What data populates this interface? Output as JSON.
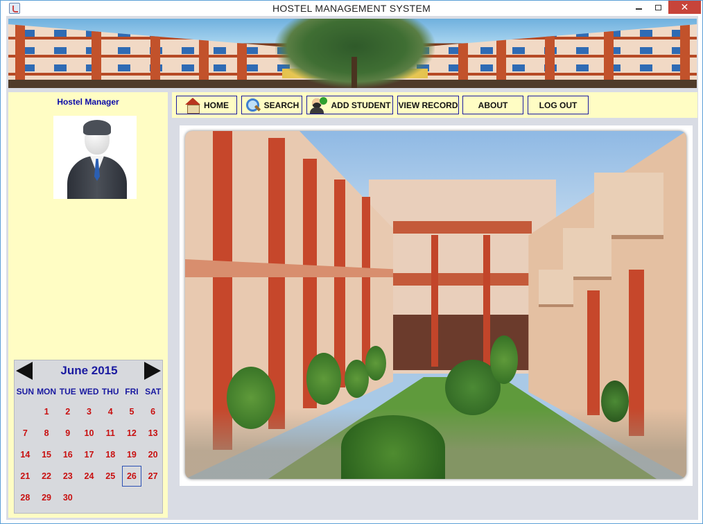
{
  "window": {
    "title": "HOSTEL MANAGEMENT SYSTEM",
    "close_symbol": "✕"
  },
  "sidebar": {
    "manager_label": "Hostel Manager"
  },
  "toolbar": {
    "home": "HOME",
    "search": "SEARCH",
    "add_student": "ADD STUDENT",
    "view_record": "VIEW RECORD",
    "about": "ABOUT",
    "logout": "LOG OUT"
  },
  "calendar": {
    "month_label": "June 2015",
    "weekdays": [
      "SUN",
      "MON",
      "TUE",
      "WED",
      "THU",
      "FRI",
      "SAT"
    ],
    "first_weekday_index": 1,
    "days_in_month": 30,
    "selected_day": 26
  },
  "colors": {
    "panel_bg": "#fffdc4",
    "accent_text": "#1a1aa0",
    "day_text": "#c81010",
    "close_button": "#c7443a"
  },
  "icons": [
    "java-app-icon",
    "home-icon",
    "search-icon",
    "add-student-icon",
    "prev-month-icon",
    "next-month-icon",
    "manager-avatar"
  ]
}
